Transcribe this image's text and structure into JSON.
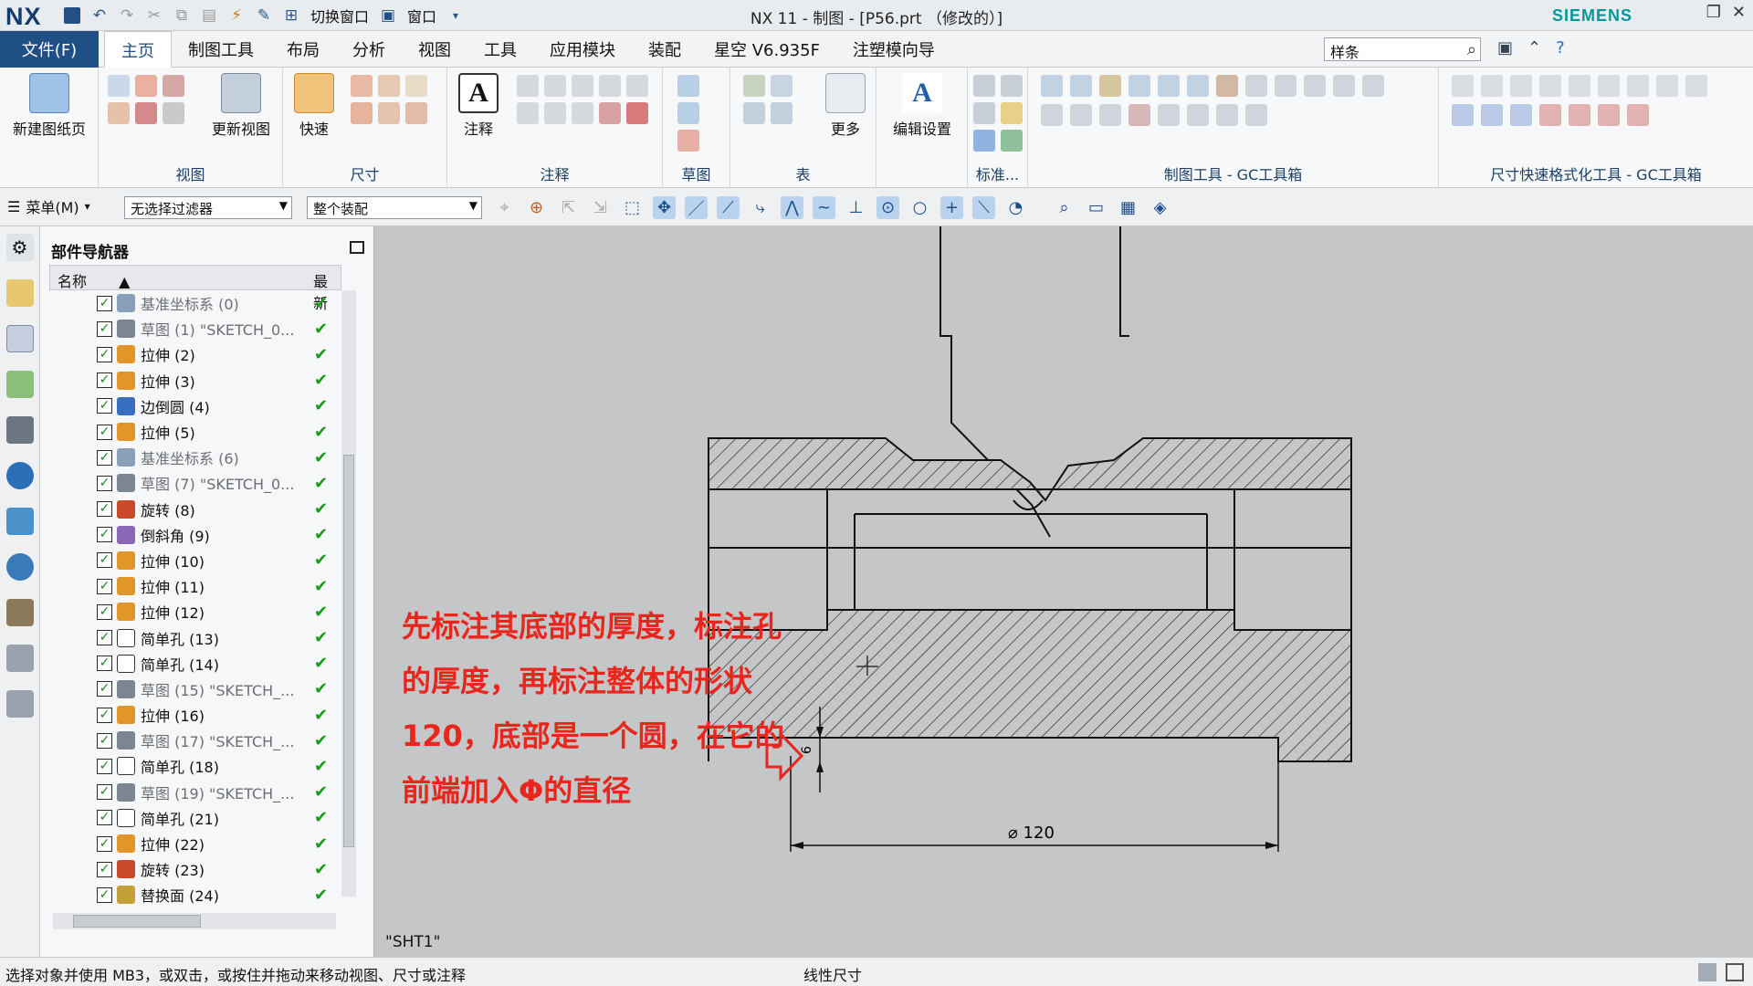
{
  "titlebar": {
    "logo": "NX",
    "switch_window": "切换窗口",
    "window_menu": "窗口",
    "title": "NX 11 - 制图 - [P56.prt （修改的）]",
    "brand": "SIEMENS"
  },
  "ribbon_tabs": {
    "file": "文件(F)",
    "tabs": [
      "主页",
      "制图工具",
      "布局",
      "分析",
      "视图",
      "工具",
      "应用模块",
      "装配",
      "星空 V6.935F",
      "注塑模向导"
    ],
    "active_index": 0,
    "search_value": "样条"
  },
  "ribbon": {
    "new_sheet": "新建图纸页",
    "view_group": "视图",
    "update_view": "更新视图",
    "rapid": "快速",
    "dimension_group": "尺寸",
    "annotation_btn": "注释",
    "annotation_group": "注释",
    "sketch_group": "草图",
    "table_group": "表",
    "more": "更多",
    "edit_settings": "编辑设置",
    "standard_group": "标准...",
    "draft_tools_group": "制图工具 - GC工具箱",
    "dim_format_group": "尺寸快速格式化工具 - GC工具箱"
  },
  "cmdbar": {
    "menu": "菜单(M)",
    "filter": "无选择过滤器",
    "scope": "整个装配"
  },
  "navigator": {
    "title": "部件导航器",
    "col_name": "名称",
    "col_latest": "最新",
    "items": [
      {
        "label": "基准坐标系 (0)",
        "type": "datum",
        "gray": true
      },
      {
        "label": "草图 (1) \"SKETCH_0...",
        "type": "sketch",
        "gray": true
      },
      {
        "label": "拉伸 (2)",
        "type": "extrude",
        "gray": false
      },
      {
        "label": "拉伸 (3)",
        "type": "extrude",
        "gray": false
      },
      {
        "label": "边倒圆 (4)",
        "type": "blend",
        "gray": false
      },
      {
        "label": "拉伸 (5)",
        "type": "extrude",
        "gray": false
      },
      {
        "label": "基准坐标系 (6)",
        "type": "datum",
        "gray": true
      },
      {
        "label": "草图 (7) \"SKETCH_0...",
        "type": "sketch",
        "gray": true
      },
      {
        "label": "旋转 (8)",
        "type": "revolve",
        "gray": false
      },
      {
        "label": "倒斜角 (9)",
        "type": "chamfer",
        "gray": false
      },
      {
        "label": "拉伸 (10)",
        "type": "extrude",
        "gray": false
      },
      {
        "label": "拉伸 (11)",
        "type": "extrude",
        "gray": false
      },
      {
        "label": "拉伸 (12)",
        "type": "extrude",
        "gray": false
      },
      {
        "label": "简单孔 (13)",
        "type": "hole",
        "gray": false
      },
      {
        "label": "简单孔 (14)",
        "type": "hole",
        "gray": false
      },
      {
        "label": "草图 (15) \"SKETCH_...",
        "type": "sketch",
        "gray": true
      },
      {
        "label": "拉伸 (16)",
        "type": "extrude",
        "gray": false
      },
      {
        "label": "草图 (17) \"SKETCH_...",
        "type": "sketch",
        "gray": true
      },
      {
        "label": "简单孔 (18)",
        "type": "hole",
        "gray": false
      },
      {
        "label": "草图 (19) \"SKETCH_...",
        "type": "sketch",
        "gray": true
      },
      {
        "label": "简单孔 (21)",
        "type": "hole",
        "gray": false
      },
      {
        "label": "拉伸 (22)",
        "type": "extrude",
        "gray": false
      },
      {
        "label": "旋转 (23)",
        "type": "revolve",
        "gray": false
      },
      {
        "label": "替换面 (24)",
        "type": "replace",
        "gray": false
      }
    ]
  },
  "drawing": {
    "dim_thickness": "6",
    "dim_diameter": "⌀ 120",
    "sheet_name": "\"SHT1\""
  },
  "overlay_note": "先标注其底部的厚度，标注孔的厚度，再标注整体的形状120，底部是一个圆，在它的前端加入Φ的直径",
  "status": {
    "prompt": "选择对象并使用 MB3，或双击，或按住并拖动来移动视图、尺寸或注释",
    "mode": "线性尺寸"
  },
  "colors": {
    "accent": "#1f4f85",
    "note": "#e8261e",
    "ok": "#1a9a1a"
  }
}
